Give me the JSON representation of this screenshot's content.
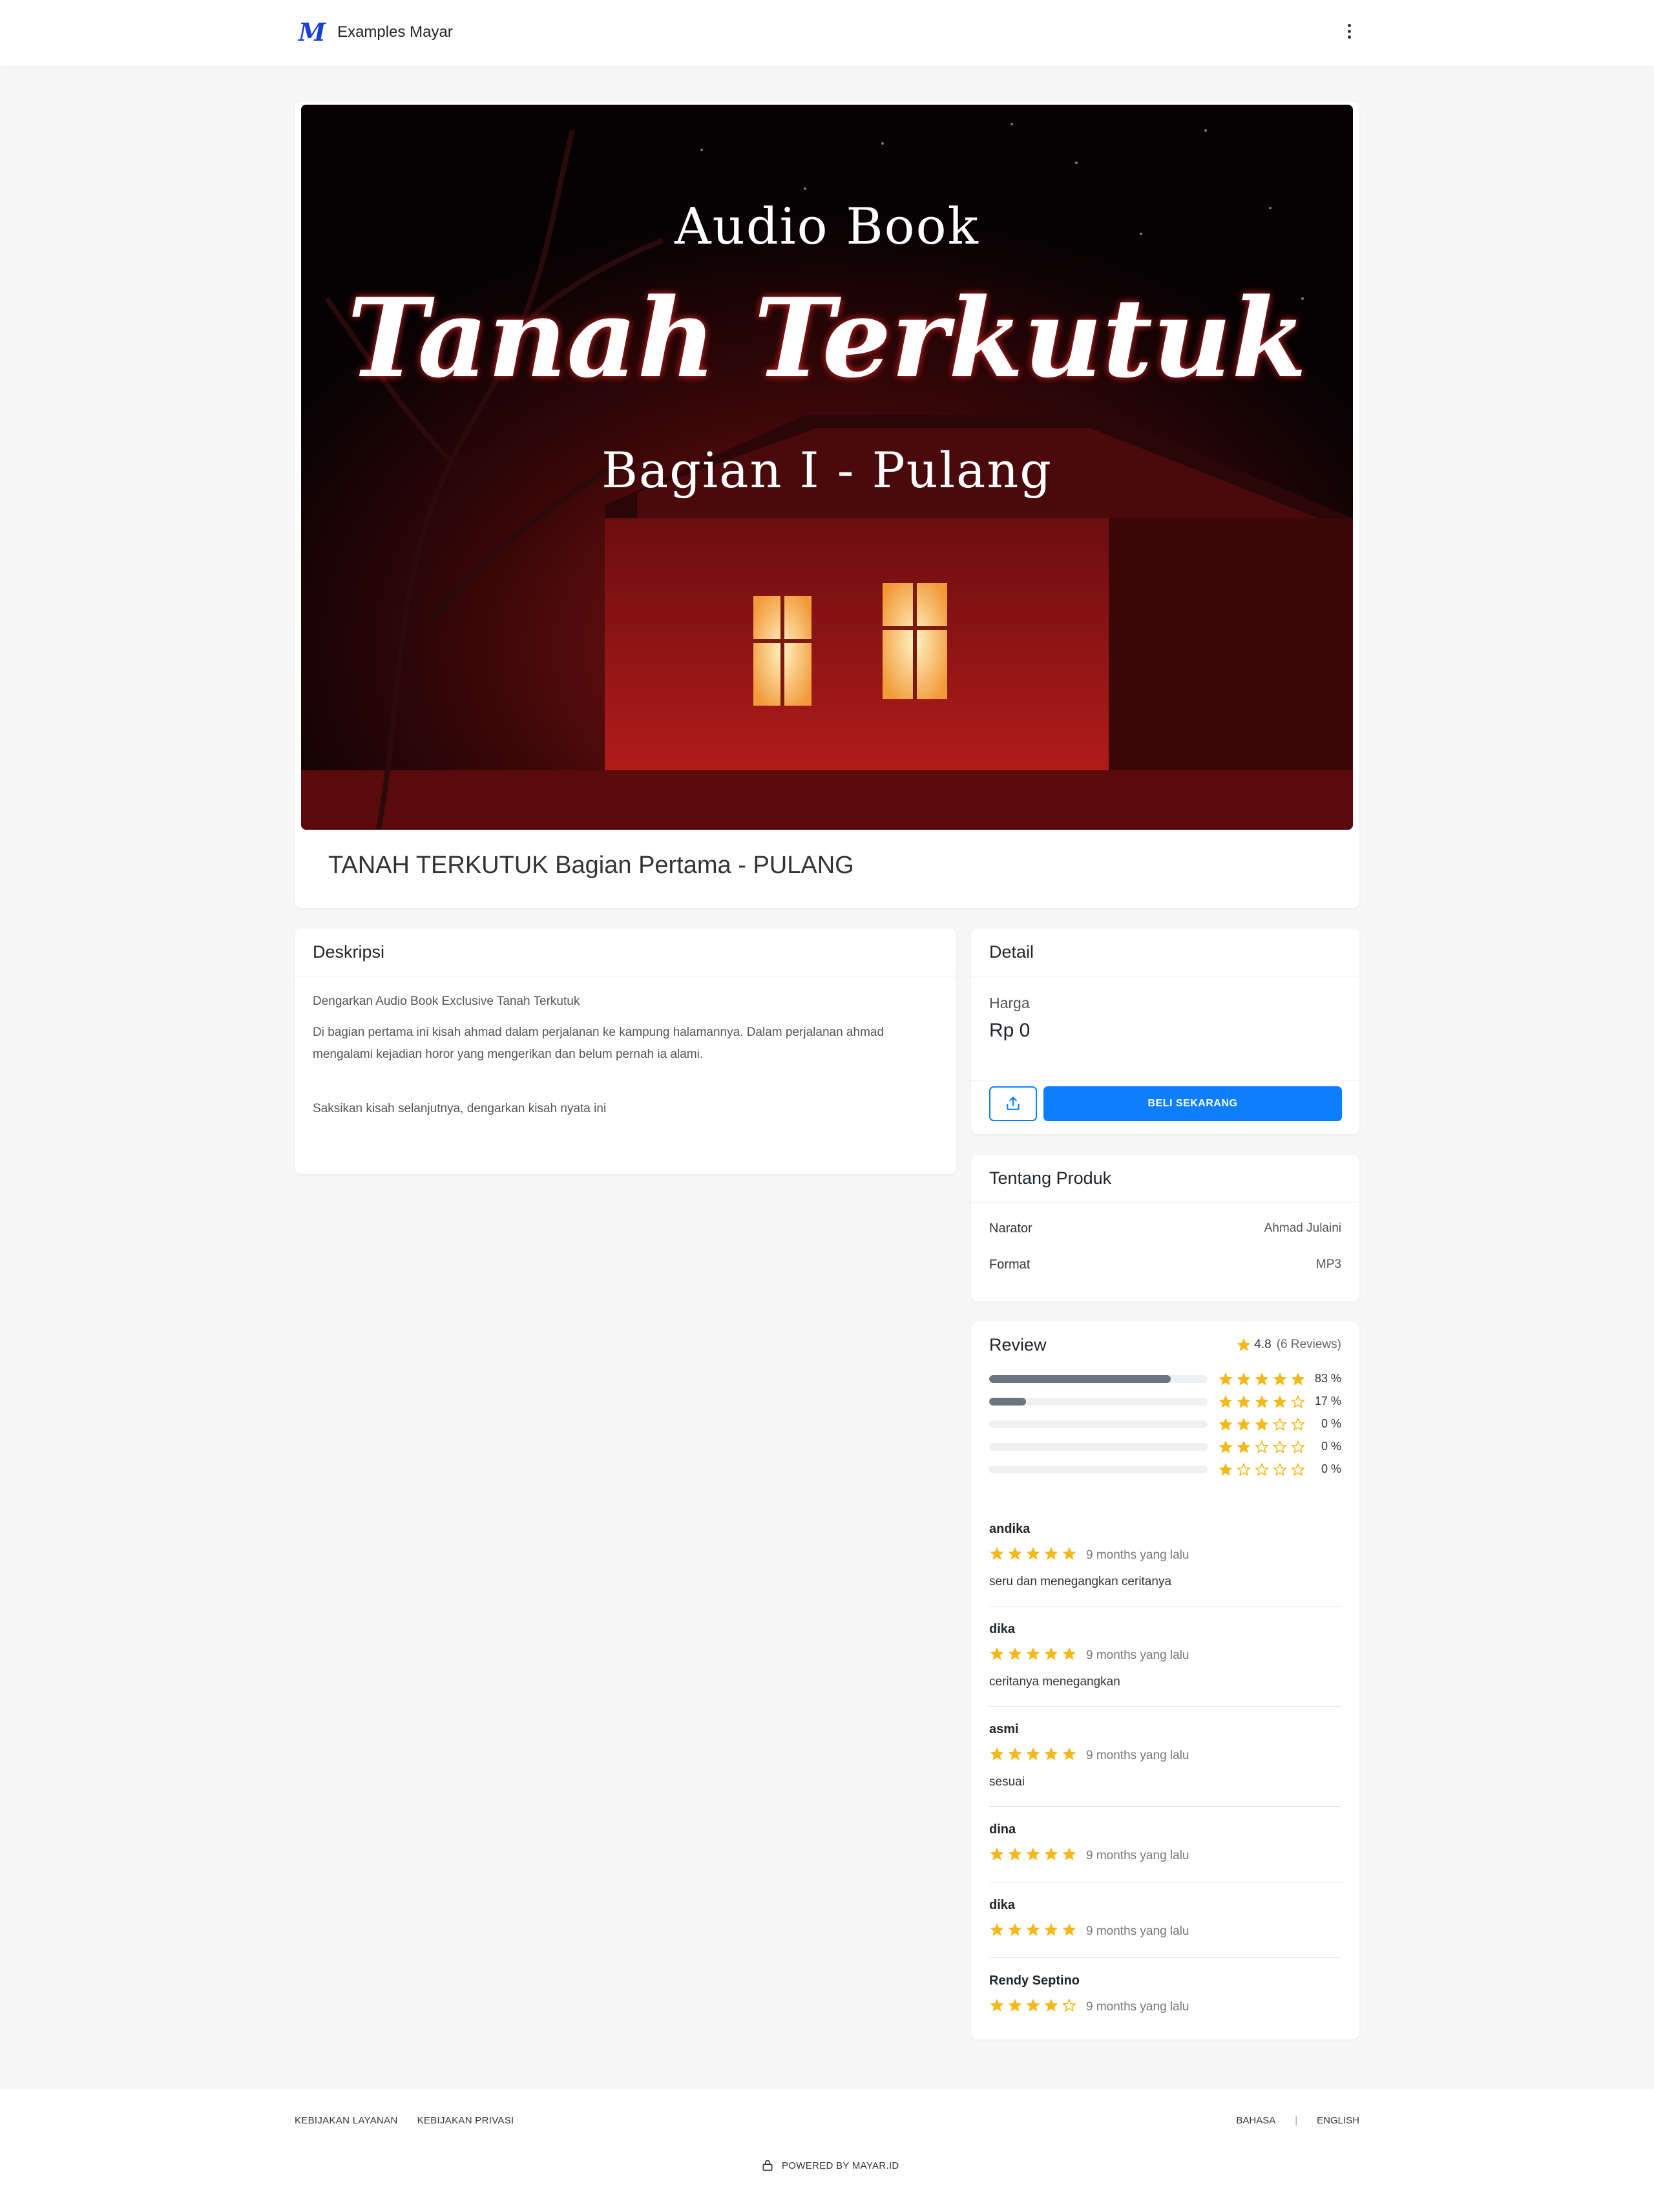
{
  "header": {
    "brand_name": "Examples Mayar",
    "menu_icon": "kebab-menu-icon"
  },
  "product": {
    "cover": {
      "line1": "Audio Book",
      "line2": "Tanah Terkutuk",
      "line3": "Bagian I - Pulang"
    },
    "title": "TANAH TERKUTUK Bagian Pertama - PULANG"
  },
  "description": {
    "heading": "Deskripsi",
    "paragraphs": [
      "Dengarkan Audio Book Exclusive Tanah Terkutuk",
      "Di bagian pertama ini kisah ahmad dalam perjalanan ke kampung halamannya. Dalam perjalanan ahmad mengalami kejadian horor yang mengerikan dan belum pernah ia alami.",
      "Saksikan kisah selanjutnya, dengarkan kisah nyata ini"
    ]
  },
  "detail": {
    "heading": "Detail",
    "price_label": "Harga",
    "price_value": "Rp 0",
    "share_icon": "share-icon",
    "buy_label": "BELI SEKARANG"
  },
  "about": {
    "heading": "Tentang Produk",
    "specs": [
      {
        "key": "Narator",
        "value": "Ahmad Julaini"
      },
      {
        "key": "Format",
        "value": "MP3"
      }
    ]
  },
  "review": {
    "heading": "Review",
    "average": "4.8",
    "count_text": "(6 Reviews)",
    "distribution": [
      {
        "stars": 5,
        "percent": 83,
        "label": "83 %"
      },
      {
        "stars": 4,
        "percent": 17,
        "label": "17 %"
      },
      {
        "stars": 3,
        "percent": 0,
        "label": "0 %"
      },
      {
        "stars": 2,
        "percent": 0,
        "label": "0 %"
      },
      {
        "stars": 1,
        "percent": 0,
        "label": "0 %"
      }
    ],
    "items": [
      {
        "name": "andika",
        "rating": 5,
        "time": "9 months yang lalu",
        "text": "seru dan menegangkan ceritanya"
      },
      {
        "name": "dika",
        "rating": 5,
        "time": "9 months yang lalu",
        "text": "ceritanya menegangkan"
      },
      {
        "name": "asmi",
        "rating": 5,
        "time": "9 months yang lalu",
        "text": "sesuai"
      },
      {
        "name": "dina",
        "rating": 5,
        "time": "9 months yang lalu",
        "text": ""
      },
      {
        "name": "dika",
        "rating": 5,
        "time": "9 months yang lalu",
        "text": ""
      },
      {
        "name": "Rendy Septino",
        "rating": 4,
        "time": "9 months yang lalu",
        "text": ""
      }
    ]
  },
  "footer": {
    "links": [
      "KEBIJAKAN LAYANAN",
      "KEBIJAKAN PRIVASI"
    ],
    "lang_label": "BAHASA",
    "lang_value": "ENGLISH",
    "powered": "POWERED BY MAYAR.ID"
  },
  "colors": {
    "accent": "#0d7ffc",
    "star": "#f5b819",
    "bar": "#6c757d"
  }
}
